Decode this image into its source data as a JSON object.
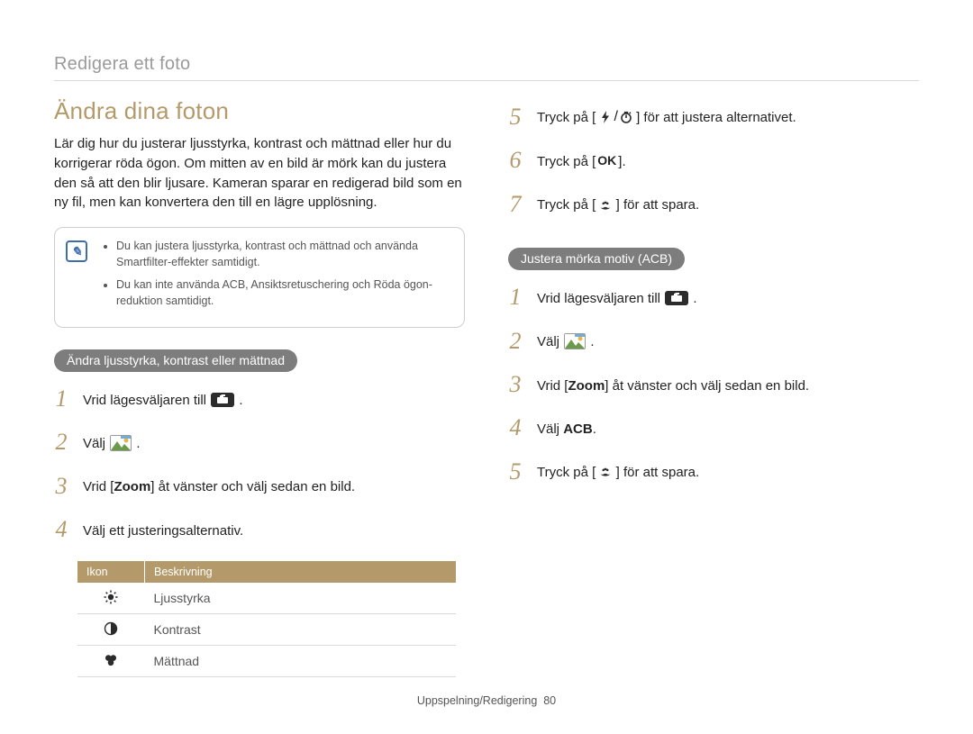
{
  "page": {
    "header": "Redigera ett foto",
    "footer_section": "Uppspelning/Redigering",
    "footer_page": "80"
  },
  "left": {
    "title": "Ändra dina foton",
    "intro": "Lär dig hur du justerar ljusstyrka, kontrast och mättnad eller hur du korrigerar röda ögon. Om mitten av en bild är mörk kan du justera den så att den blir ljusare. Kameran sparar en redigerad bild som en ny fil, men kan konvertera den till en lägre upplösning.",
    "notes": [
      "Du kan justera ljusstyrka, kontrast och mättnad och använda Smartfilter-effekter samtidigt.",
      "Du kan inte använda ACB, Ansiktsretuschering och Röda ögon-reduktion samtidigt."
    ],
    "section1_pill": "Ändra ljusstyrka, kontrast eller mättnad",
    "steps1": {
      "s1a": "Vrid lägesväljaren till ",
      "s1b": ".",
      "s2a": "Välj ",
      "s2b": ".",
      "s3a": "Vrid [",
      "s3b": "Zoom",
      "s3c": "] åt vänster och välj sedan en bild.",
      "s4": "Välj ett justeringsalternativ."
    },
    "table": {
      "h1": "Ikon",
      "h2": "Beskrivning",
      "r1": "Ljusstyrka",
      "r2": "Kontrast",
      "r3": "Mättnad"
    }
  },
  "right": {
    "cont_steps": {
      "s5a": "Tryck på [",
      "s5b": "] för att justera alternativet.",
      "s6a": "Tryck på [",
      "s6b": "].",
      "s7a": "Tryck på [",
      "s7b": "] för att spara."
    },
    "section2_pill": "Justera mörka motiv (ACB)",
    "steps2": {
      "s1a": "Vrid lägesväljaren till ",
      "s1b": ".",
      "s2a": "Välj ",
      "s2b": ".",
      "s3a": "Vrid [",
      "s3b": "Zoom",
      "s3c": "] åt vänster och välj sedan en bild.",
      "s4a": "Välj ",
      "s4b": "ACB",
      "s4c": ".",
      "s5a": "Tryck på [",
      "s5b": "] för att spara."
    }
  },
  "chart_data": {
    "type": "table",
    "title": "Justeringsalternativ",
    "columns": [
      "Ikon",
      "Beskrivning"
    ],
    "rows": [
      [
        "brightness",
        "Ljusstyrka"
      ],
      [
        "contrast",
        "Kontrast"
      ],
      [
        "saturation",
        "Mättnad"
      ]
    ]
  }
}
